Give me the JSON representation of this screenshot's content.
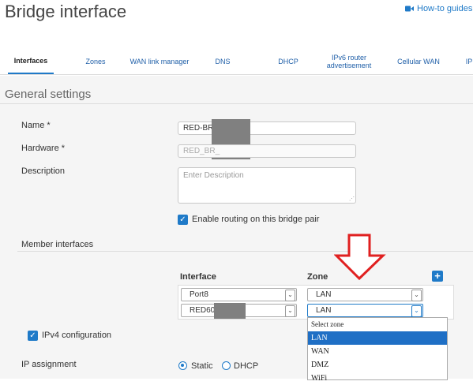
{
  "page": {
    "title": "Bridge interface",
    "how_to": "How-to guides"
  },
  "tabs": [
    {
      "label": "Interfaces"
    },
    {
      "label": "Zones"
    },
    {
      "label": "WAN link manager"
    },
    {
      "label": "DNS"
    },
    {
      "label": "DHCP"
    },
    {
      "label": "IPv6 router advertisement"
    },
    {
      "label": "Cellular WAN"
    },
    {
      "label": "IP"
    }
  ],
  "general": {
    "heading": "General settings",
    "name_label": "Name *",
    "name_value": "RED-BR-",
    "hardware_label": "Hardware *",
    "hardware_value": "RED_BR_",
    "description_label": "Description",
    "description_placeholder": "Enter Description",
    "routing_label": "Enable routing on this bridge pair"
  },
  "members": {
    "heading": "Member interfaces",
    "col_interface": "Interface",
    "col_zone": "Zone",
    "rows": [
      {
        "interface": "Port8",
        "zone": "LAN"
      },
      {
        "interface": "RED60-",
        "zone": "LAN"
      }
    ],
    "dropdown_options": [
      "Select zone",
      "LAN",
      "WAN",
      "DMZ",
      "WiFi"
    ],
    "dropdown_selected": "LAN"
  },
  "ipv4": {
    "label": "IPv4 configuration",
    "ip_assignment_label": "IP assignment",
    "static_label": "Static",
    "dhcp_label": "DHCP",
    "selected": "Static"
  },
  "colors": {
    "accent": "#1f7ac8",
    "annotation_arrow": "#e02020",
    "mask": "#808080"
  }
}
